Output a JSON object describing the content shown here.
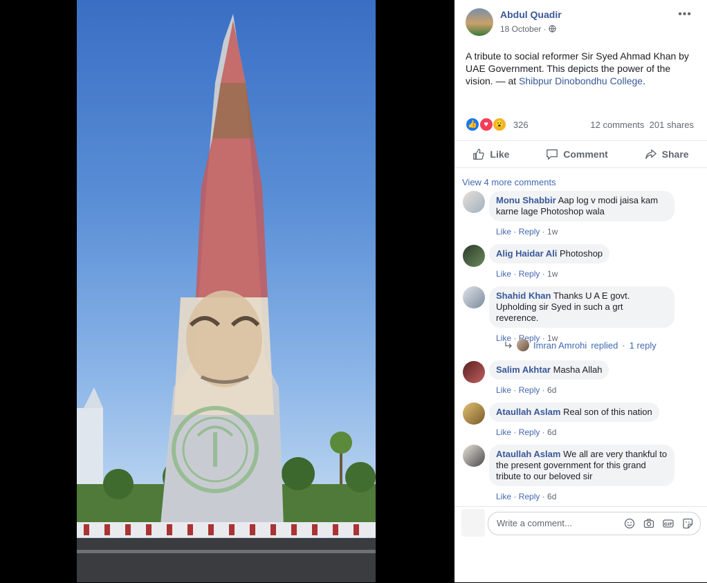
{
  "post": {
    "author": "Abdul Quadir",
    "date": "18 October",
    "text": "A tribute to social reformer Sir Syed Ahmad Khan by UAE Government. This depicts the power of the vision. — at ",
    "location": "Shibpur Dinobondhu College",
    "location_suffix": ".",
    "reaction_count": "326",
    "comments_count": "12 comments",
    "shares_count": "201 shares"
  },
  "actions": {
    "like": "Like",
    "comment": "Comment",
    "share": "Share"
  },
  "view_more": "View 4 more comments",
  "comments": [
    {
      "name": "Monu Shabbir",
      "text": "Aap log v modi jaisa kam karne lage Photoshop wala",
      "like": "Like",
      "reply": "Reply",
      "time": "1w"
    },
    {
      "name": "Alig Haidar Ali",
      "text": "Photoshop",
      "like": "Like",
      "reply": "Reply",
      "time": "1w"
    },
    {
      "name": "Shahid Khan",
      "text": "Thanks U A E govt. Upholding sir Syed in such a grt reverence.",
      "like": "Like",
      "reply": "Reply",
      "time": "1w"
    },
    {
      "name": "Salim Akhtar",
      "text": "Masha Allah",
      "like": "Like",
      "reply": "Reply",
      "time": "6d"
    },
    {
      "name": "Ataullah Aslam",
      "text": "Real son of this nation",
      "like": "Like",
      "reply": "Reply",
      "time": "6d"
    },
    {
      "name": "Ataullah Aslam",
      "text": "We all are very thankful to the present government for this grand tribute to our beloved sir",
      "like": "Like",
      "reply": "Reply",
      "time": "6d"
    }
  ],
  "reply_summary": {
    "name": "Imran Amrohi",
    "action": "replied",
    "count": "1 reply"
  },
  "write_comment": {
    "placeholder": "Write a comment..."
  },
  "colors": {
    "link": "#385898",
    "like_blue": "#4267b2",
    "bubble": "#f2f3f5"
  },
  "icons": [
    "like-reaction-icon",
    "love-reaction-icon",
    "wow-reaction-icon",
    "globe-icon",
    "more-icon",
    "thumb-up-icon",
    "comment-icon",
    "share-icon",
    "emoji-icon",
    "camera-icon",
    "gif-icon",
    "sticker-icon"
  ]
}
